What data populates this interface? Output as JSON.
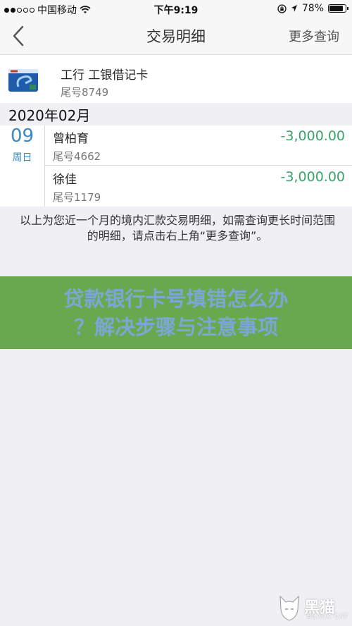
{
  "status_bar": {
    "carrier": "中国移动",
    "time": "下午9:19",
    "battery": "78%",
    "battery_level": 0.78,
    "signal_bars": 2,
    "icons": [
      "signal-dots-icon",
      "wifi-icon",
      "lock-rotation-icon",
      "location-icon",
      "battery-icon"
    ]
  },
  "nav": {
    "title": "交易明细",
    "more": "更多查询",
    "back_icon": "chevron-left-icon"
  },
  "card": {
    "name": "工行 工银借记卡",
    "tail": "尾号8749",
    "icon": "bank-card-icon"
  },
  "month": "2020年02月",
  "group": {
    "day": "09",
    "weekday": "周日",
    "transactions": [
      {
        "name": "曾柏育",
        "tail": "尾号4662",
        "amount": "-3,000.00"
      },
      {
        "name": "徐佳",
        "tail": "尾号1179",
        "amount": "-3,000.00"
      }
    ]
  },
  "note": "以上为您近一个月的境内汇款交易明细，如需查询更长时间范围的明细，请点击右上角“更多查询”。",
  "banner": {
    "line1": "贷款银行卡号填错怎么办",
    "line2": "？解决步骤与注意事项"
  },
  "watermark": {
    "cn": "黑猫",
    "en": "BLACK CAT"
  },
  "colors": {
    "accent_blue": "#3a88c6",
    "amount_green": "#3aa36a",
    "banner_bg": "#6aa84f",
    "banner_text": "#7aa7d4"
  }
}
